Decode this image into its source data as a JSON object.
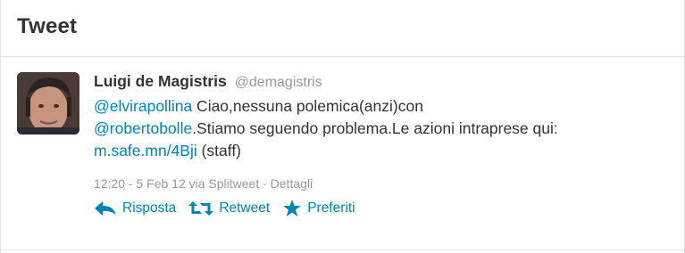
{
  "header": {
    "title": "Tweet"
  },
  "tweet": {
    "fullname": "Luigi de Magistris",
    "screenname": "@demagistris",
    "mention1": "@elvirapollina",
    "text1": " Ciao,nessuna polemica(anzi)con",
    "mention2": "@robertobolle",
    "text2": ".Stiamo seguendo problema.Le azioni intraprese qui:",
    "url": "m.safe.mn/4Bji",
    "text3": " (staff)",
    "meta": "12:20 - 5 Feb 12 via Splitweet · Dettagli"
  },
  "actions": {
    "reply": "Risposta",
    "retweet": "Retweet",
    "favorite": "Preferiti"
  },
  "icons": {
    "reply": "reply-arrow-icon",
    "retweet": "retweet-icon",
    "favorite": "star-icon"
  },
  "colors": {
    "link": "#0084b4",
    "meta": "#999999",
    "text": "#333333"
  }
}
